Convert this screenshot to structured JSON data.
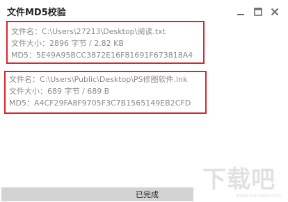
{
  "window": {
    "title": "文件MD5校验",
    "minimize_icon": "minimize-icon",
    "maximize_icon": "maximize-icon",
    "close_icon": "close-icon"
  },
  "files": [
    {
      "name_label": "文件名：",
      "name_value": "C:\\Users\\27213\\Desktop\\阅读.txt",
      "size_label": "文件大小：",
      "size_value": "2896 字节 /  2.82 KB",
      "md5_label": "MD5：",
      "md5_value": "5E49A95BCC3872E16F81691F673818A4"
    },
    {
      "name_label": "文件名：",
      "name_value": "C:\\Users\\Public\\Desktop\\PS修图软件.lnk",
      "size_label": "文件大小：",
      "size_value": "689 字节 /  689 B",
      "md5_label": "MD5：",
      "md5_value": "A4CF29FA8F9705F3C7B1565149EB2CFD"
    }
  ],
  "status": {
    "text": "已完成",
    "progress": 1.0
  },
  "watermark": {
    "logo_text": "下载吧",
    "url": "www.xiazaiba.com"
  },
  "colors": {
    "highlight_border": "#d8262b",
    "info_text": "#8a8a8a",
    "progress_bar": "#d3d3d3"
  }
}
